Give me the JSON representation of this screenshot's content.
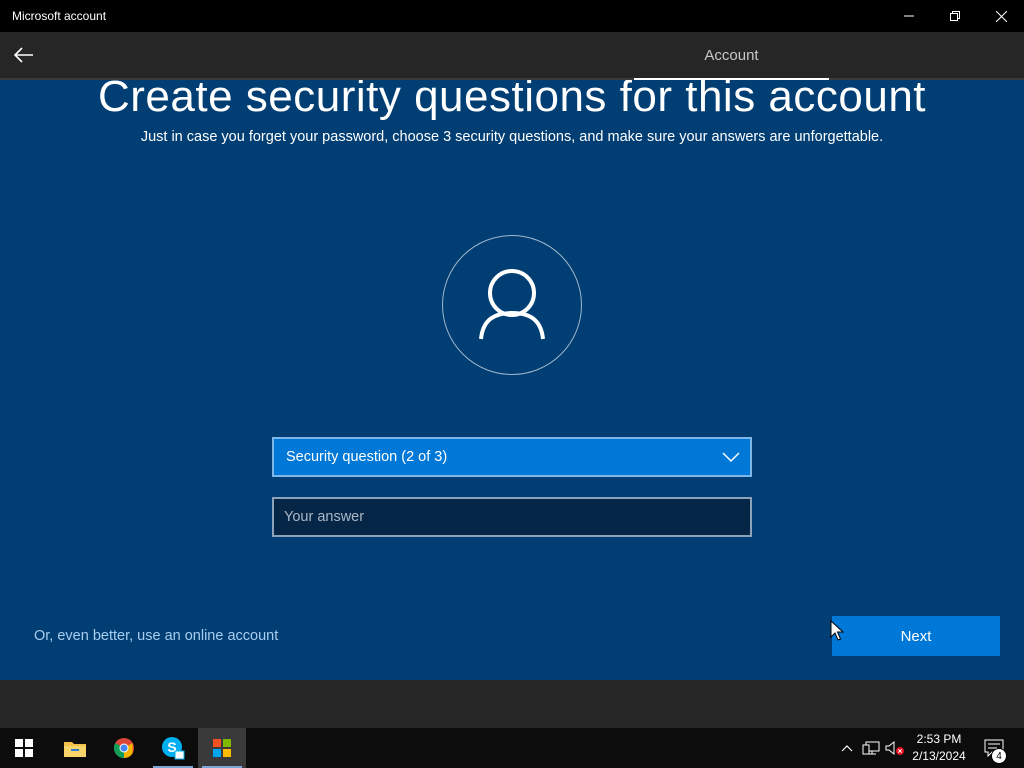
{
  "window": {
    "title": "Microsoft account"
  },
  "header": {
    "tab_label": "Account"
  },
  "main": {
    "heading": "Create security questions for this account",
    "subheading": "Just in case you forget your password, choose 3 security questions, and make sure your answers are unforgettable.",
    "security_question": {
      "selected": "Security question (2 of 3)"
    },
    "answer": {
      "placeholder": "Your answer",
      "value": ""
    },
    "online_account_link": "Or, even better, use an online account",
    "next_label": "Next"
  },
  "taskbar": {
    "apps": [
      {
        "icon": "windows-start-icon"
      },
      {
        "icon": "file-explorer-icon"
      },
      {
        "icon": "chrome-icon"
      },
      {
        "icon": "skype-icon"
      },
      {
        "icon": "microsoft-store-icon"
      }
    ],
    "clock": {
      "time": "2:53 PM",
      "date": "2/13/2024"
    },
    "notifications_count": "4"
  },
  "colors": {
    "main_bg": "#003e73",
    "accent": "#0078d7",
    "header_bg": "#262626",
    "link": "#a7cdf0"
  }
}
